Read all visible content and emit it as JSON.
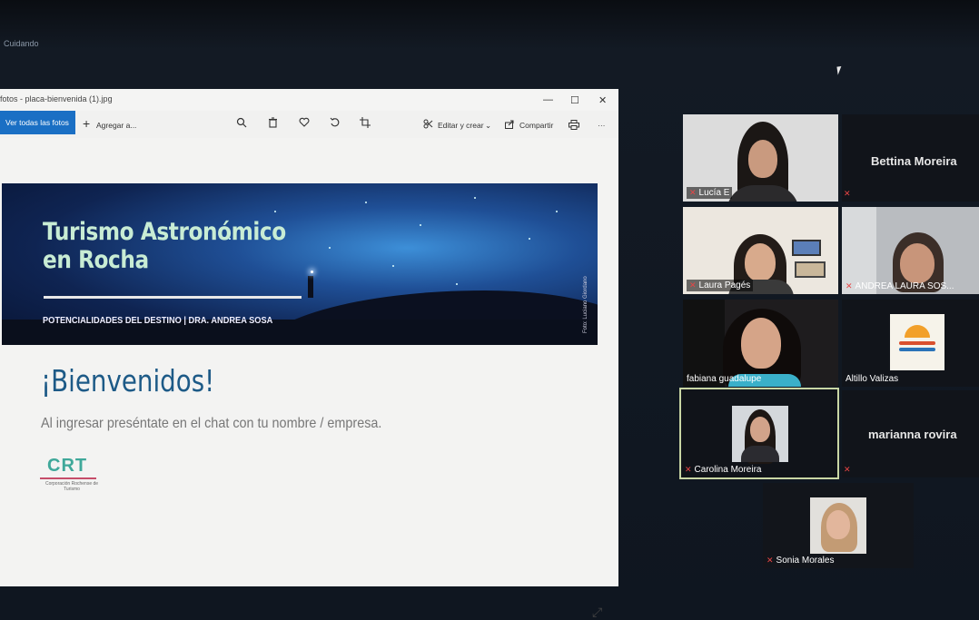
{
  "screen": {
    "top_label": "Cuidando"
  },
  "photos_window": {
    "title": "fotos - placa-bienvenida (1).jpg",
    "window_controls": {
      "minimize": "—",
      "maximize": "☐",
      "close": "✕"
    },
    "toolbar": {
      "view_all": "Ver todas las fotos",
      "add_to": "Agregar a...",
      "edit_create": "Editar y crear",
      "share": "Compartir",
      "more": "···"
    }
  },
  "slide": {
    "banner_title_line1": "Turismo Astronómico",
    "banner_title_line2": "en Rocha",
    "banner_subtitle": "POTENCIALIDADES DEL DESTINO |  DRA. ANDREA SOSA",
    "photo_credit": "Foto: Luciano Giordano",
    "welcome": "¡Bienvenidos!",
    "instruction": "Al ingresar preséntate en el chat con tu nombre / empresa.",
    "logo_text": "CRT",
    "logo_sub": "Corporación Rochense de Turismo"
  },
  "participants": [
    {
      "name": "Lucía E",
      "muted": true
    },
    {
      "name": "Bettina Moreira",
      "muted": true
    },
    {
      "name": "Laura Pagés",
      "muted": true
    },
    {
      "name": "ANDREA LAURA SOS...",
      "muted": true
    },
    {
      "name": "fabiana guadalupe",
      "muted": false
    },
    {
      "name": "Altillo Valizas",
      "muted": false
    },
    {
      "name": "Carolina Moreira",
      "muted": true
    },
    {
      "name": "marianna rovira",
      "muted": true
    },
    {
      "name": "Sonia Morales",
      "muted": true
    }
  ],
  "colors": {
    "accent": "#1a6fc4",
    "welcome": "#1d5a87",
    "muted_mic": "#e84545",
    "active_speaker_border": "#c9d6a4"
  }
}
